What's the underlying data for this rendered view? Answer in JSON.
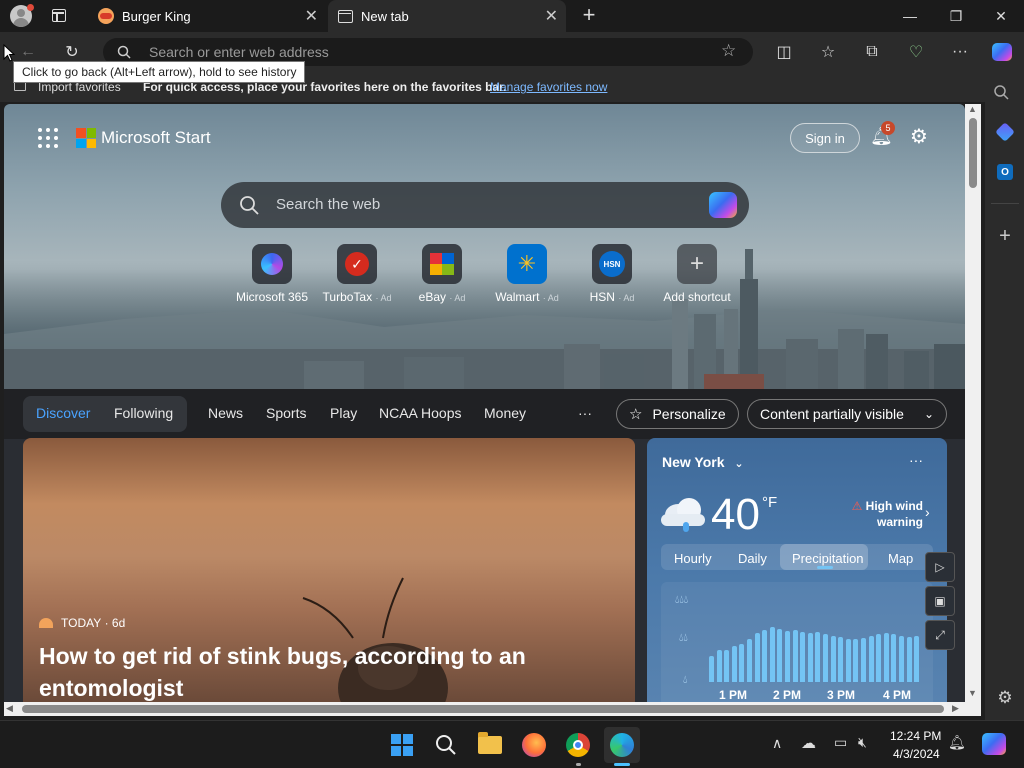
{
  "browser": {
    "tabs": [
      {
        "label": "Burger King",
        "active": false
      },
      {
        "label": "New tab",
        "active": true
      }
    ],
    "address_placeholder": "Search or enter web address",
    "tooltip": "Click to go back (Alt+Left arrow), hold to see history",
    "favorites_bar": {
      "import_label": "Import favorites",
      "message": "For quick access, place your favorites here on the favorites bar.",
      "manage_link": "Manage favorites now"
    }
  },
  "start": {
    "brand": "Microsoft Start",
    "sign_in": "Sign in",
    "notification_count": "5",
    "search_placeholder": "Search the web",
    "quick_links": [
      {
        "label": "Microsoft 365",
        "ad": ""
      },
      {
        "label": "TurboTax",
        "ad": "· Ad"
      },
      {
        "label": "eBay",
        "ad": "· Ad"
      },
      {
        "label": "Walmart",
        "ad": "· Ad"
      },
      {
        "label": "HSN",
        "ad": "· Ad"
      },
      {
        "label": "Add shortcut",
        "ad": ""
      }
    ],
    "hsn_logo": "HSN",
    "nav": {
      "discover": "Discover",
      "following": "Following",
      "items": [
        "News",
        "Sports",
        "Play",
        "NCAA Hoops",
        "Money"
      ],
      "more": "···",
      "personalize": "Personalize",
      "content_visibility": "Content partially visible"
    },
    "news": {
      "source": "TODAY",
      "age": "· 6d",
      "headline_line1": "How to get rid of stink bugs, according to an",
      "headline_line2": "entomologist"
    },
    "weather": {
      "location": "New York",
      "temp": "40",
      "unit": "°F",
      "alert_line1": "High wind",
      "alert_line2": "warning",
      "tabs": [
        "Hourly",
        "Daily",
        "Precipitation",
        "Map"
      ],
      "active_tab": "Precipitation",
      "precip_levels": [
        0.42,
        0.51,
        0.51,
        0.58,
        0.62,
        0.7,
        0.79,
        0.84,
        0.88,
        0.86,
        0.83,
        0.84,
        0.81,
        0.79,
        0.8,
        0.77,
        0.74,
        0.73,
        0.7,
        0.7,
        0.71,
        0.74,
        0.77,
        0.79,
        0.77,
        0.74,
        0.72,
        0.74
      ],
      "time_labels": [
        "1 PM",
        "2 PM",
        "3 PM",
        "4 PM"
      ]
    }
  },
  "taskbar": {
    "time": "12:24 PM",
    "date": "4/3/2024"
  },
  "colors": {
    "accent_link": "#7db9ff",
    "discover_active": "#4aa3ff",
    "precip_bar": "#74c4f4"
  }
}
